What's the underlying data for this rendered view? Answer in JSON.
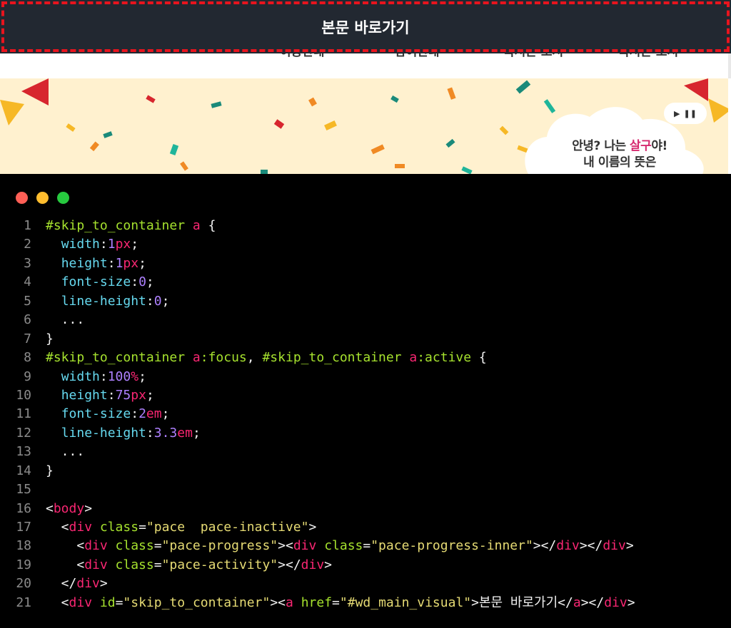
{
  "site": {
    "skip_link_label": "본문 바로가기",
    "nav_items": [
      "이용안내",
      "참여안내",
      "독서온 도서",
      "독서온 도서"
    ],
    "banner": {
      "play_icon": "play-icon",
      "pause_icon": "pause-icon",
      "greeting_prefix": "안녕? 나는 ",
      "greeting_name": "살구",
      "greeting_suffix": "야!",
      "greeting_line2": "내 이름의 뜻은"
    }
  },
  "editor": {
    "window_buttons": [
      {
        "name": "close",
        "color": "#ff5f56"
      },
      {
        "name": "minimize",
        "color": "#ffbd2e"
      },
      {
        "name": "maximize",
        "color": "#27c93f"
      }
    ],
    "lines": [
      {
        "n": "1",
        "tokens": [
          [
            "sel",
            "#skip_to_container "
          ],
          [
            "tag",
            "a"
          ],
          [
            "pun",
            " {"
          ]
        ]
      },
      {
        "n": "2",
        "tokens": [
          [
            "pun",
            "  "
          ],
          [
            "prop",
            "width"
          ],
          [
            "pun",
            ":"
          ],
          [
            "num",
            "1"
          ],
          [
            "unit",
            "px"
          ],
          [
            "pun",
            ";"
          ]
        ]
      },
      {
        "n": "3",
        "tokens": [
          [
            "pun",
            "  "
          ],
          [
            "prop",
            "height"
          ],
          [
            "pun",
            ":"
          ],
          [
            "num",
            "1"
          ],
          [
            "unit",
            "px"
          ],
          [
            "pun",
            ";"
          ]
        ]
      },
      {
        "n": "4",
        "tokens": [
          [
            "pun",
            "  "
          ],
          [
            "prop",
            "font-size"
          ],
          [
            "pun",
            ":"
          ],
          [
            "num",
            "0"
          ],
          [
            "pun",
            ";"
          ]
        ]
      },
      {
        "n": "5",
        "tokens": [
          [
            "pun",
            "  "
          ],
          [
            "prop",
            "line-height"
          ],
          [
            "pun",
            ":"
          ],
          [
            "num",
            "0"
          ],
          [
            "pun",
            ";"
          ]
        ]
      },
      {
        "n": "6",
        "tokens": [
          [
            "pun",
            "  ..."
          ]
        ]
      },
      {
        "n": "7",
        "tokens": [
          [
            "pun",
            "}"
          ]
        ]
      },
      {
        "n": "8",
        "tokens": [
          [
            "sel",
            "#skip_to_container "
          ],
          [
            "tag",
            "a"
          ],
          [
            "sel",
            ":focus"
          ],
          [
            "pun",
            ", "
          ],
          [
            "sel",
            "#skip_to_container "
          ],
          [
            "tag",
            "a"
          ],
          [
            "sel",
            ":active"
          ],
          [
            "pun",
            " {"
          ]
        ]
      },
      {
        "n": "9",
        "tokens": [
          [
            "pun",
            "  "
          ],
          [
            "prop",
            "width"
          ],
          [
            "pun",
            ":"
          ],
          [
            "num",
            "100"
          ],
          [
            "unit",
            "%"
          ],
          [
            "pun",
            ";"
          ]
        ]
      },
      {
        "n": "10",
        "tokens": [
          [
            "pun",
            "  "
          ],
          [
            "prop",
            "height"
          ],
          [
            "pun",
            ":"
          ],
          [
            "num",
            "75"
          ],
          [
            "unit",
            "px"
          ],
          [
            "pun",
            ";"
          ]
        ]
      },
      {
        "n": "11",
        "tokens": [
          [
            "pun",
            "  "
          ],
          [
            "prop",
            "font-size"
          ],
          [
            "pun",
            ":"
          ],
          [
            "num",
            "2"
          ],
          [
            "unit",
            "em"
          ],
          [
            "pun",
            ";"
          ]
        ]
      },
      {
        "n": "12",
        "tokens": [
          [
            "pun",
            "  "
          ],
          [
            "prop",
            "line-height"
          ],
          [
            "pun",
            ":"
          ],
          [
            "num",
            "3.3"
          ],
          [
            "unit",
            "em"
          ],
          [
            "pun",
            ";"
          ]
        ]
      },
      {
        "n": "13",
        "tokens": [
          [
            "pun",
            "  ..."
          ]
        ]
      },
      {
        "n": "14",
        "tokens": [
          [
            "pun",
            "}"
          ]
        ]
      },
      {
        "n": "15",
        "tokens": []
      },
      {
        "n": "16",
        "tokens": [
          [
            "pun",
            "<"
          ],
          [
            "tag",
            "body"
          ],
          [
            "pun",
            ">"
          ]
        ]
      },
      {
        "n": "17",
        "tokens": [
          [
            "pun",
            "  <"
          ],
          [
            "tag",
            "div "
          ],
          [
            "attr",
            "class"
          ],
          [
            "pun",
            "="
          ],
          [
            "str",
            "\"pace  pace-inactive\""
          ],
          [
            "pun",
            ">"
          ]
        ]
      },
      {
        "n": "18",
        "tokens": [
          [
            "pun",
            "    <"
          ],
          [
            "tag",
            "div "
          ],
          [
            "attr",
            "class"
          ],
          [
            "pun",
            "="
          ],
          [
            "str",
            "\"pace-progress\""
          ],
          [
            "pun",
            "><"
          ],
          [
            "tag",
            "div "
          ],
          [
            "attr",
            "class"
          ],
          [
            "pun",
            "="
          ],
          [
            "str",
            "\"pace-progress-inner\""
          ],
          [
            "pun",
            "></"
          ],
          [
            "tag",
            "div"
          ],
          [
            "pun",
            "></"
          ],
          [
            "tag",
            "div"
          ],
          [
            "pun",
            ">"
          ]
        ]
      },
      {
        "n": "19",
        "tokens": [
          [
            "pun",
            "    <"
          ],
          [
            "tag",
            "div "
          ],
          [
            "attr",
            "class"
          ],
          [
            "pun",
            "="
          ],
          [
            "str",
            "\"pace-activity\""
          ],
          [
            "pun",
            "></"
          ],
          [
            "tag",
            "div"
          ],
          [
            "pun",
            ">"
          ]
        ]
      },
      {
        "n": "20",
        "tokens": [
          [
            "pun",
            "  </"
          ],
          [
            "tag",
            "div"
          ],
          [
            "pun",
            ">"
          ]
        ]
      },
      {
        "n": "21",
        "tokens": [
          [
            "pun",
            "  <"
          ],
          [
            "tag",
            "div "
          ],
          [
            "attr",
            "id"
          ],
          [
            "pun",
            "="
          ],
          [
            "str",
            "\"skip_to_container\""
          ],
          [
            "pun",
            "><"
          ],
          [
            "tag",
            "a "
          ],
          [
            "attr",
            "href"
          ],
          [
            "pun",
            "="
          ],
          [
            "str",
            "\"#wd_main_visual\""
          ],
          [
            "pun",
            ">본문 바로가기</"
          ],
          [
            "tag",
            "a"
          ],
          [
            "pun",
            "></"
          ],
          [
            "tag",
            "div"
          ],
          [
            "pun",
            ">"
          ]
        ]
      }
    ]
  }
}
